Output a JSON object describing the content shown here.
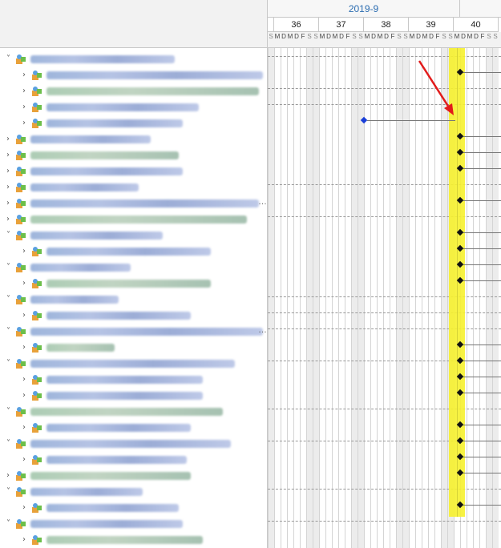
{
  "gantt": {
    "month_label": "2019-9",
    "weeks": [
      "36",
      "37",
      "38",
      "39",
      "40"
    ],
    "day_letters": [
      "S",
      "M",
      "D",
      "M",
      "D",
      "F",
      "S"
    ],
    "visible_day_letters": "SMDMDFSSMDMDFSSMDMDFSSMDMDFSSMDMDFSS"
  },
  "tree": {
    "rows": [
      {
        "level": 0,
        "expanded": true,
        "icon": "task-group-icon",
        "text_blurred": true
      },
      {
        "level": 1,
        "expanded": false,
        "icon": "task-group-icon",
        "text_blurred": true
      },
      {
        "level": 1,
        "expanded": false,
        "icon": "task-group-icon",
        "text_blurred": true
      },
      {
        "level": 1,
        "expanded": false,
        "icon": "task-group-icon",
        "text_blurred": true
      },
      {
        "level": 1,
        "expanded": false,
        "icon": "task-group-icon",
        "text_blurred": true
      },
      {
        "level": 0,
        "expanded": false,
        "icon": "task-group-icon",
        "text_blurred": true
      },
      {
        "level": 0,
        "expanded": false,
        "icon": "task-group-icon",
        "text_blurred": true
      },
      {
        "level": 0,
        "expanded": false,
        "icon": "task-group-icon",
        "text_blurred": true
      },
      {
        "level": 0,
        "expanded": false,
        "icon": "task-group-icon",
        "text_blurred": true
      },
      {
        "level": 0,
        "expanded": false,
        "icon": "task-group-icon",
        "text_blurred": true,
        "truncated": true
      },
      {
        "level": 0,
        "expanded": false,
        "icon": "task-group-icon",
        "text_blurred": true
      },
      {
        "level": 0,
        "expanded": true,
        "icon": "task-group-icon",
        "text_blurred": true
      },
      {
        "level": 1,
        "expanded": false,
        "icon": "task-group-icon",
        "text_blurred": true
      },
      {
        "level": 0,
        "expanded": true,
        "icon": "task-group-icon",
        "text_blurred": true
      },
      {
        "level": 1,
        "expanded": false,
        "icon": "task-group-icon",
        "text_blurred": true
      },
      {
        "level": 0,
        "expanded": true,
        "icon": "task-group-icon",
        "text_blurred": true
      },
      {
        "level": 1,
        "expanded": false,
        "icon": "task-group-icon",
        "text_blurred": true
      },
      {
        "level": 0,
        "expanded": true,
        "icon": "task-group-icon",
        "text_blurred": true,
        "truncated": true
      },
      {
        "level": 1,
        "expanded": false,
        "icon": "task-group-icon",
        "text_blurred": true
      },
      {
        "level": 0,
        "expanded": true,
        "icon": "task-group-icon",
        "text_blurred": true
      },
      {
        "level": 1,
        "expanded": false,
        "icon": "task-group-icon",
        "text_blurred": true
      },
      {
        "level": 1,
        "expanded": false,
        "icon": "task-group-icon",
        "text_blurred": true
      },
      {
        "level": 0,
        "expanded": true,
        "icon": "task-group-icon",
        "text_blurred": true
      },
      {
        "level": 1,
        "expanded": false,
        "icon": "task-group-icon",
        "text_blurred": true
      },
      {
        "level": 0,
        "expanded": true,
        "icon": "task-group-icon",
        "text_blurred": true
      },
      {
        "level": 1,
        "expanded": false,
        "icon": "task-group-icon",
        "text_blurred": true
      },
      {
        "level": 0,
        "expanded": false,
        "icon": "task-group-icon",
        "text_blurred": true
      },
      {
        "level": 0,
        "expanded": true,
        "icon": "task-group-icon",
        "text_blurred": true
      },
      {
        "level": 1,
        "expanded": false,
        "icon": "task-group-icon",
        "text_blurred": true
      },
      {
        "level": 0,
        "expanded": true,
        "icon": "task-group-icon",
        "text_blurred": true
      },
      {
        "level": 1,
        "expanded": false,
        "icon": "task-group-icon",
        "text_blurred": true
      }
    ]
  },
  "colors": {
    "highlight": "#f6f12f",
    "arrow": "#e21b1b",
    "milestone": "#111111",
    "milestone_alt": "#1a3fd8",
    "month_text": "#2b6cb0"
  }
}
